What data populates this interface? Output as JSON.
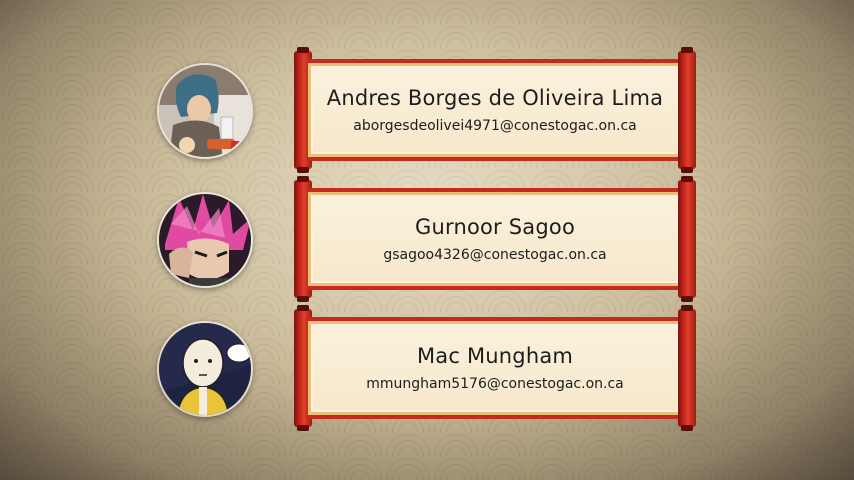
{
  "team": [
    {
      "name": "Andres Borges de Oliveira Lima",
      "email": "aborgesdeolivei4971@conestogac.on.ca",
      "avatar_icon": "avatar-blue-hair-anime-character"
    },
    {
      "name": "Gurnoor Sagoo",
      "email": "gsagoo4326@conestogac.on.ca",
      "avatar_icon": "avatar-pink-hair-anime-character"
    },
    {
      "name": "Mac Mungham",
      "email": "mmungham5176@conestogac.on.ca",
      "avatar_icon": "avatar-bald-hero-anime-character"
    }
  ],
  "colors": {
    "scroll_red": "#c62a1c",
    "paper": "#fbf1dc",
    "text": "#1d1d1d"
  }
}
